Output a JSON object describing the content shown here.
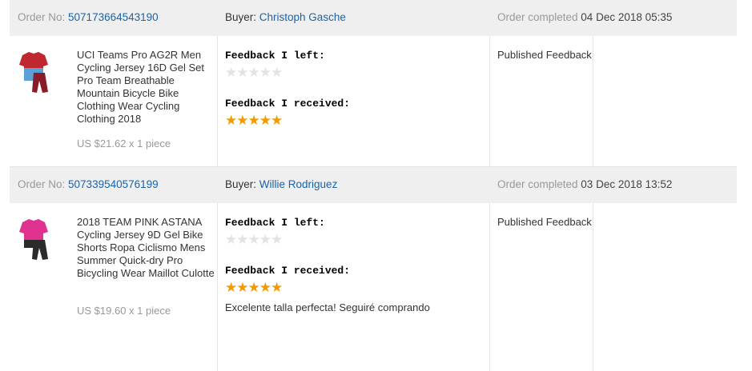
{
  "orders": [
    {
      "order_label": "Order No: ",
      "order_no": "507173664543190",
      "buyer_label": "Buyer: ",
      "buyer": "Christoph Gasche",
      "completed_label": "Order completed ",
      "completed": "04 Dec 2018 05:35",
      "product_title": "UCI Teams Pro AG2R Men Cycling Jersey 16D Gel Set Pro Team Breathable Mountain Bicycle Bike Clothing Wear Cycling Clothing 2018",
      "price": "US $21.62 x 1 piece",
      "feedback_left_label": "Feedback I left:",
      "feedback_left_rating": 0,
      "feedback_received_label": "Feedback I received:",
      "feedback_received_rating": 5,
      "comment": "",
      "status": "Published Feedback",
      "jersey_colors": [
        "#c0282f",
        "#5a9fd6"
      ]
    },
    {
      "order_label": "Order No: ",
      "order_no": "507339540576199",
      "buyer_label": "Buyer: ",
      "buyer": "Willie Rodriguez",
      "completed_label": "Order completed ",
      "completed": "03 Dec 2018 13:52",
      "product_title": "2018 TEAM PINK ASTANA Cycling Jersey 9D Gel Bike Shorts Ropa Ciclismo Mens Summer Quick-dry Pro Bicycling Wear Maillot Culotte",
      "price": "US $19.60 x 1 piece",
      "feedback_left_label": "Feedback I left:",
      "feedback_left_rating": 0,
      "feedback_received_label": "Feedback I received:",
      "feedback_received_rating": 5,
      "comment": "Excelente talla perfecta! Seguiré comprando",
      "status": "Published Feedback",
      "jersey_colors": [
        "#e0338f",
        "#2b2b2b"
      ]
    }
  ],
  "star_char": "★"
}
